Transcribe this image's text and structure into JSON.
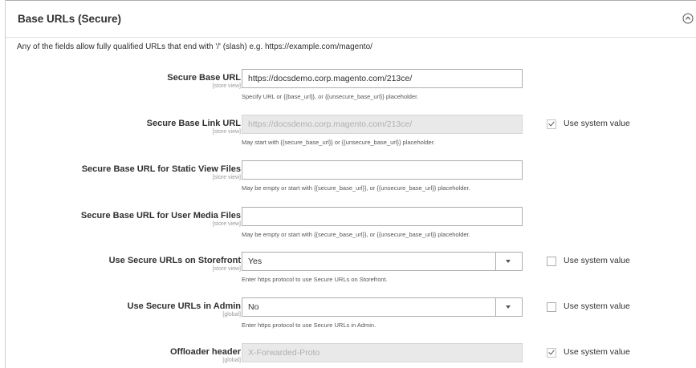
{
  "section": {
    "title": "Base URLs (Secure)",
    "collapse_icon": "circle-chevron-up-icon"
  },
  "intro": "Any of the fields allow fully qualified URLs that end with '/' (slash) e.g. https://example.com/magento/",
  "fields": [
    {
      "label": "Secure Base URL",
      "scope": "[store view]",
      "type": "text",
      "value": "https://docsdemo.corp.magento.com/213ce/",
      "disabled": false,
      "note": "Specify URL or {{base_url}}, or {{unsecure_base_url}} placeholder."
    },
    {
      "label": "Secure Base Link URL",
      "scope": "[store view]",
      "type": "text",
      "value": "https://docsdemo.corp.magento.com/213ce/",
      "disabled": true,
      "note": "May start with {{secure_base_url}} or {{unsecure_base_url}} placeholder.",
      "use_system_value": {
        "label": "Use system value",
        "checked": true
      }
    },
    {
      "label": "Secure Base URL for Static View Files",
      "scope": "[store view]",
      "type": "text",
      "value": "",
      "disabled": false,
      "note": "May be empty or start with {{secure_base_url}}, or {{unsecure_base_url}} placeholder."
    },
    {
      "label": "Secure Base URL for User Media Files",
      "scope": "[store view]",
      "type": "text",
      "value": "",
      "disabled": false,
      "note": "May be empty or start with {{secure_base_url}}, or {{unsecure_base_url}} placeholder."
    },
    {
      "label": "Use Secure URLs on Storefront",
      "scope": "[store view]",
      "type": "select",
      "value": "Yes",
      "note": "Enter https protocol to use Secure URLs on Storefront.",
      "use_system_value": {
        "label": "Use system value",
        "checked": false
      }
    },
    {
      "label": "Use Secure URLs in Admin",
      "scope": "[global]",
      "type": "select",
      "value": "No",
      "note": "Enter https protocol to use Secure URLs in Admin.",
      "use_system_value": {
        "label": "Use system value",
        "checked": false
      }
    },
    {
      "label": "Offloader header",
      "scope": "[global]",
      "type": "text",
      "value": "X-Forwarded-Proto",
      "disabled": true,
      "use_system_value": {
        "label": "Use system value",
        "checked": true
      }
    }
  ]
}
